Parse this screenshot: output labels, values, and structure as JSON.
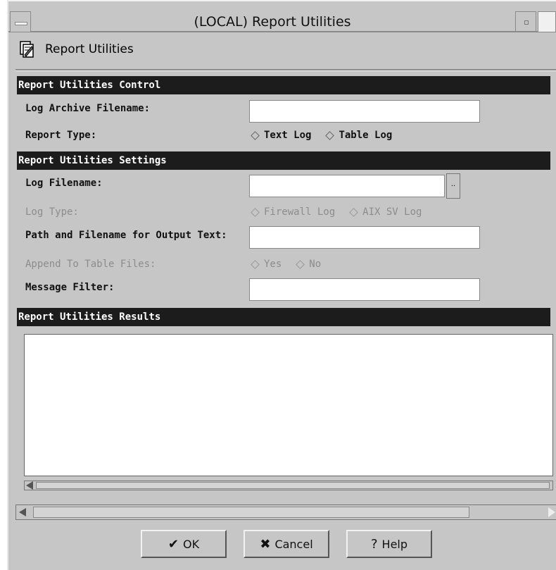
{
  "window": {
    "title": "(LOCAL) Report Utilities",
    "header_title": "Report Utilities"
  },
  "control_section": {
    "title": "Report Utilities Control",
    "log_archive_label": "Log Archive Filename:",
    "log_archive_value": "",
    "report_type_label": "Report Type:",
    "report_type_options": [
      "Text Log",
      "Table Log"
    ]
  },
  "settings_section": {
    "title": "Report Utilities Settings",
    "log_filename_label": "Log Filename:",
    "log_filename_value": "",
    "browse_label": "..",
    "log_type_label": "Log Type:",
    "log_type_options": [
      "Firewall Log",
      "AIX SV Log"
    ],
    "output_path_label": "Path and Filename for Output Text:",
    "output_path_value": "",
    "append_label": "Append To Table Files:",
    "append_options": [
      "Yes",
      "No"
    ],
    "message_filter_label": "Message Filter:",
    "message_filter_value": ""
  },
  "results_section": {
    "title": "Report Utilities Results",
    "content": ""
  },
  "buttons": {
    "ok": "OK",
    "cancel": "Cancel",
    "help": "Help"
  },
  "icons": {
    "ok": "checkmark-icon",
    "cancel": "x-icon",
    "help": "question-icon",
    "header": "report-icon"
  }
}
